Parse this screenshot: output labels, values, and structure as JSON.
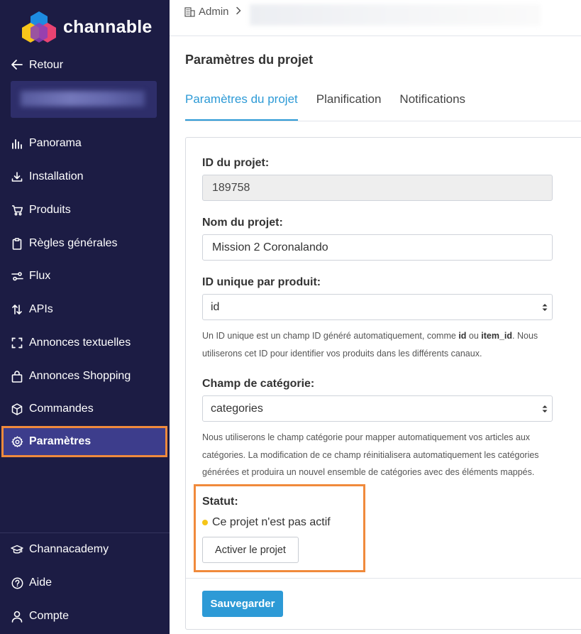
{
  "app": {
    "name": "channable"
  },
  "sidebar": {
    "back_label": "Retour",
    "items": [
      {
        "label": "Panorama",
        "icon": "chart-icon"
      },
      {
        "label": "Installation",
        "icon": "download-icon"
      },
      {
        "label": "Produits",
        "icon": "cart-icon"
      },
      {
        "label": "Règles générales",
        "icon": "clipboard-icon"
      },
      {
        "label": "Flux",
        "icon": "sliders-icon"
      },
      {
        "label": "APIs",
        "icon": "updown-arrows-icon"
      },
      {
        "label": "Annonces textuelles",
        "icon": "frame-icon"
      },
      {
        "label": "Annonces Shopping",
        "icon": "shopping-bag-icon"
      },
      {
        "label": "Commandes",
        "icon": "box-icon"
      },
      {
        "label": "Paramètres",
        "icon": "gear-icon",
        "active": true
      }
    ],
    "bottom_items": [
      {
        "label": "Channacademy",
        "icon": "graduation-cap-icon"
      },
      {
        "label": "Aide",
        "icon": "help-circle-icon"
      },
      {
        "label": "Compte",
        "icon": "user-icon"
      }
    ]
  },
  "breadcrumb": {
    "root": "Admin"
  },
  "main": {
    "title": "Paramètres du projet",
    "tabs": [
      {
        "label": "Paramètres du projet",
        "active": true
      },
      {
        "label": "Planification"
      },
      {
        "label": "Notifications"
      }
    ],
    "form": {
      "project_id_label": "ID du projet:",
      "project_id_value": "189758",
      "project_name_label": "Nom du projet:",
      "project_name_value": "Mission 2 Coronalando",
      "unique_id_label": "ID unique par produit:",
      "unique_id_value": "id",
      "unique_id_help_1": "Un ID unique est un champ ID généré automatiquement, comme ",
      "unique_id_help_code1": "id",
      "unique_id_help_2": " ou ",
      "unique_id_help_code2": "item_id",
      "unique_id_help_3": ". Nous utiliserons cet ID pour identifier vos produits dans les différents canaux.",
      "category_label": "Champ de catégorie:",
      "category_value": "categories",
      "category_help": "Nous utiliserons le champ catégorie pour mapper automatiquement vos articles aux catégories. La modification de ce champ réinitialisera automatiquement les catégories générées et produira un nouvel ensemble de catégories avec des éléments mappés.",
      "status_label": "Statut:",
      "status_text": "Ce projet n'est pas actif",
      "activate_label": "Activer le projet",
      "save_label": "Sauvegarder"
    }
  },
  "colors": {
    "sidebar_bg": "#1c1c44",
    "accent": "#2d9ad6",
    "highlight": "#f08a3c",
    "status_inactive": "#f5c518"
  }
}
